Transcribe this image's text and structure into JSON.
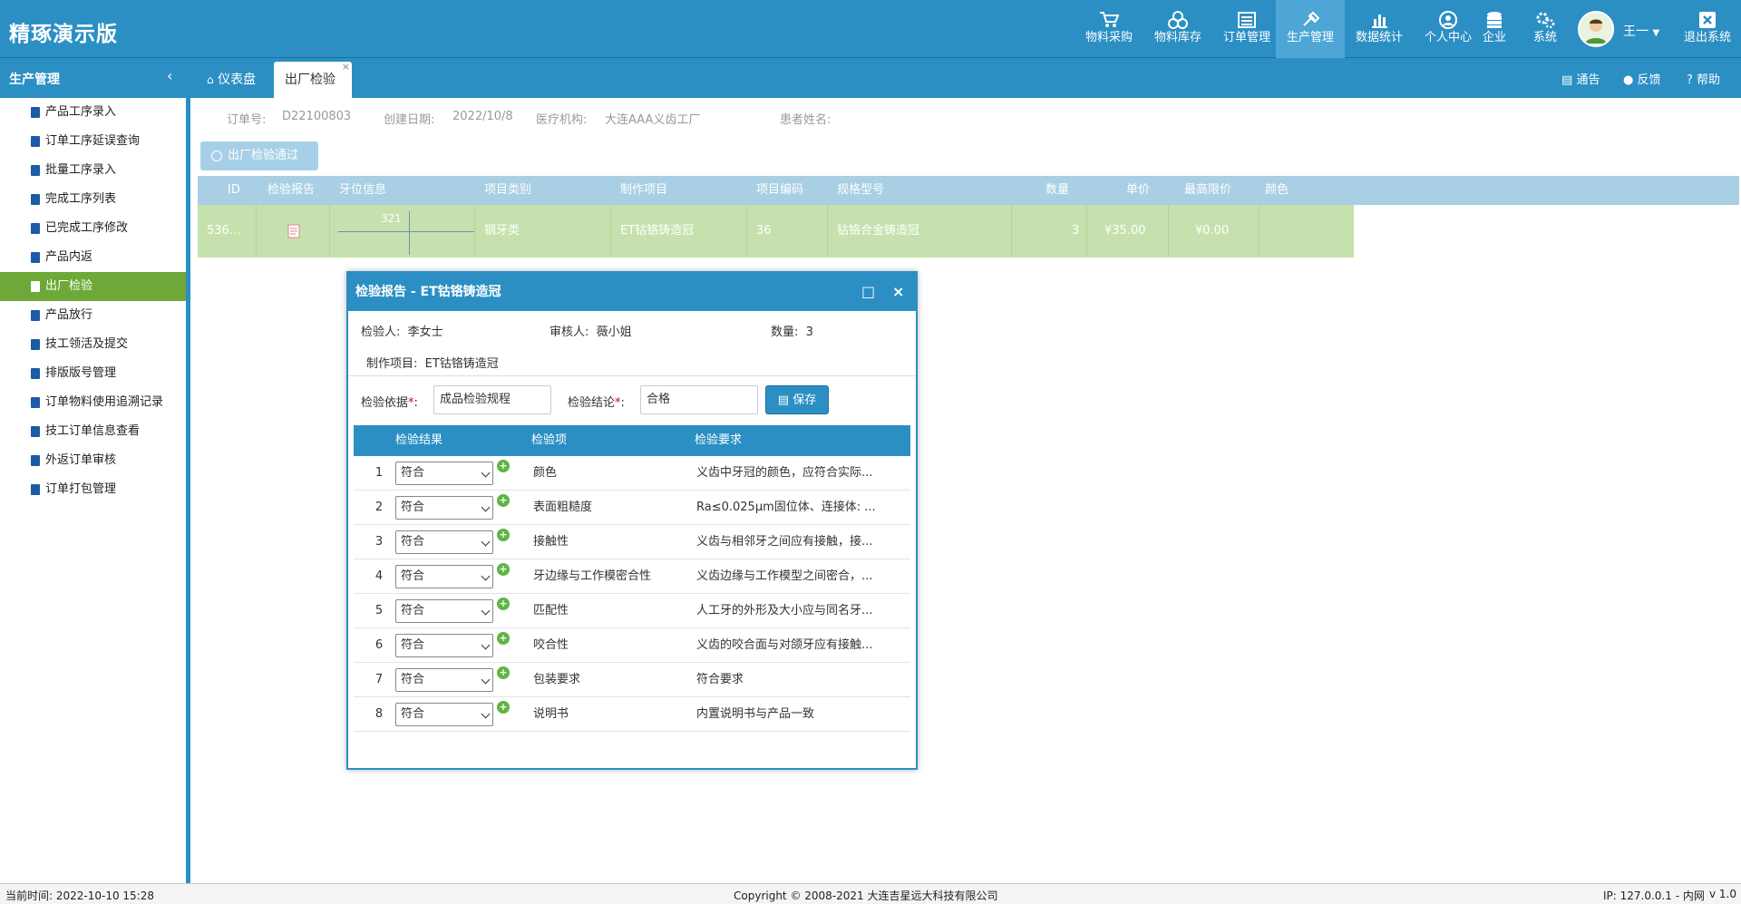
{
  "app": {
    "title": "精琢演示版"
  },
  "nav": [
    {
      "label": "物料采购",
      "icon": "cart-icon"
    },
    {
      "label": "物料库存",
      "icon": "boxes-icon"
    },
    {
      "label": "订单管理",
      "icon": "list-icon"
    },
    {
      "label": "生产管理",
      "icon": "tools-icon"
    },
    {
      "label": "数据统计",
      "icon": "bar-chart-icon"
    },
    {
      "label": "个人中心",
      "icon": "user-icon"
    },
    {
      "label": "企业",
      "icon": "database-icon"
    },
    {
      "label": "系统",
      "icon": "gear-icon"
    }
  ],
  "user": {
    "name": "王一"
  },
  "logout": {
    "label": "退出系统"
  },
  "sidebar": {
    "title": "生产管理",
    "items": [
      {
        "label": "产品工序录入"
      },
      {
        "label": "订单工序延误查询"
      },
      {
        "label": "批量工序录入"
      },
      {
        "label": "完成工序列表"
      },
      {
        "label": "已完成工序修改"
      },
      {
        "label": "产品内返"
      },
      {
        "label": "出厂检验"
      },
      {
        "label": "产品放行"
      },
      {
        "label": "技工领活及提交"
      },
      {
        "label": "排版版号管理"
      },
      {
        "label": "订单物料使用追溯记录"
      },
      {
        "label": "技工订单信息查看"
      },
      {
        "label": "外返订单审核"
      },
      {
        "label": "订单打包管理"
      }
    ]
  },
  "tabs": [
    {
      "label": "仪表盘"
    },
    {
      "label": "出厂检验"
    }
  ],
  "help": {
    "notice": "通告",
    "feedback": "反馈",
    "help": "帮助"
  },
  "order": {
    "order_no_label": "订单号:",
    "order_no": "D22100803",
    "created_label": "创建日期:",
    "created": "2022/10/8",
    "org_label": "医疗机构:",
    "org": "大连AAA义齿工厂",
    "patient_label": "患者姓名:",
    "patient": ""
  },
  "pass_button": {
    "label": "出厂检验通过"
  },
  "grid": {
    "headers": [
      "ID",
      "检验报告",
      "牙位信息",
      "项目类别",
      "制作项目",
      "项目编码",
      "规格型号",
      "数量",
      "单价",
      "最高限价",
      "颜色"
    ],
    "row": {
      "id": "536...",
      "tooth": "321",
      "category": "钢牙类",
      "project": "ET钴铬铸造冠",
      "code": "36",
      "spec": "钴铬合金铸造冠",
      "qty": "3",
      "price": "¥35.00",
      "max_price": "¥0.00",
      "color": ""
    }
  },
  "dialog": {
    "title": "检验报告 - ET钴铬铸造冠",
    "inspector_label": "检验人:",
    "inspector": "李女士",
    "reviewer_label": "审核人:",
    "reviewer": "薇小姐",
    "qty_label": "数量:",
    "qty": "3",
    "project_label": "制作项目:",
    "project": "ET钴铬铸造冠",
    "basis_label": "检验依据",
    "basis": "成品检验规程",
    "conclusion_label": "检验结论",
    "conclusion": "合格",
    "save_label": "保存",
    "table_headers": [
      "检验结果",
      "检验项",
      "检验要求"
    ],
    "rows": [
      {
        "num": "1",
        "result": "符合",
        "item": "颜色",
        "req": "义齿中牙冠的颜色，应符合实际..."
      },
      {
        "num": "2",
        "result": "符合",
        "item": "表面粗糙度",
        "req": "Ra≤0.025μm固位体、连接体: ..."
      },
      {
        "num": "3",
        "result": "符合",
        "item": "接触性",
        "req": "义齿与相邻牙之间应有接触，接..."
      },
      {
        "num": "4",
        "result": "符合",
        "item": "牙边缘与工作模密合性",
        "req": "义齿边缘与工作模型之间密合，..."
      },
      {
        "num": "5",
        "result": "符合",
        "item": "匹配性",
        "req": "人工牙的外形及大小应与同名牙..."
      },
      {
        "num": "6",
        "result": "符合",
        "item": "咬合性",
        "req": "义齿的咬合面与对颌牙应有接触..."
      },
      {
        "num": "7",
        "result": "符合",
        "item": "包装要求",
        "req": "符合要求"
      },
      {
        "num": "8",
        "result": "符合",
        "item": "说明书",
        "req": "内置说明书与产品一致"
      }
    ]
  },
  "footer": {
    "time": "当前时间:  2022-10-10 15:28",
    "copyright": "Copyright © 2008-2021 大连吉星远大科技有限公司",
    "ip": "IP: 127.0.0.1 - 内网",
    "version": "v 1.0"
  },
  "colors": {
    "primary": "#2b8fc4",
    "active_side": "#6ea838",
    "row_bg": "#c6e1ad"
  }
}
